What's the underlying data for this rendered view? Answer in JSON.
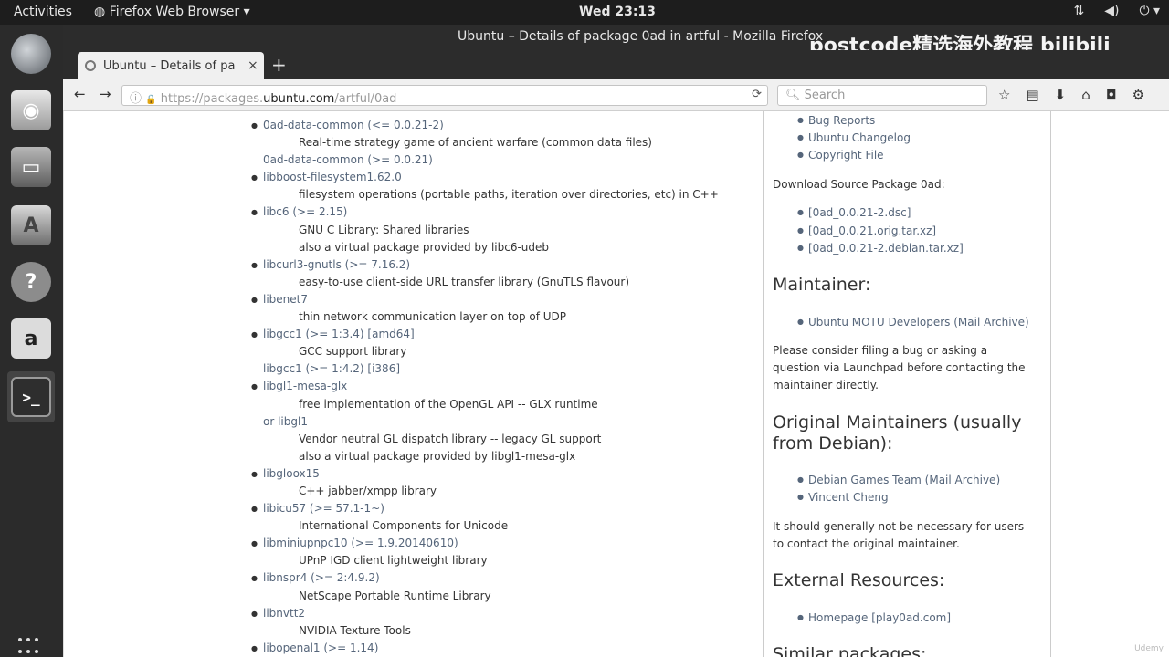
{
  "topbar": {
    "activities": "Activities",
    "app": "Firefox Web Browser ▾",
    "clock": "Wed 23:13"
  },
  "window_title": "Ubuntu – Details of package 0ad in artful - Mozilla Firefox",
  "watermark": "postcode精选海外教程 bilibili",
  "tab": {
    "label": "Ubuntu – Details of pa",
    "close": "×",
    "new": "+"
  },
  "nav": {
    "back": "←",
    "forward": "→",
    "info": "ⓘ",
    "lock": "🔒",
    "url_scheme": "https://packages.",
    "url_host": "ubuntu.com",
    "url_path": "/artful/0ad",
    "reload": "⟳",
    "search_placeholder": "Search"
  },
  "dependencies": [
    {
      "kind": "bullet",
      "text": "0ad-data-common (<= 0.0.21-2)"
    },
    {
      "kind": "desc",
      "text": "Real-time strategy game of ancient warfare (common data files)"
    },
    {
      "kind": "alt",
      "text": "0ad-data-common (>= 0.0.21)"
    },
    {
      "kind": "bullet",
      "text": "libboost-filesystem1.62.0"
    },
    {
      "kind": "desc",
      "text": "filesystem operations (portable paths, iteration over directories, etc) in C++"
    },
    {
      "kind": "bullet",
      "text": "libc6 (>= 2.15)"
    },
    {
      "kind": "desc",
      "text": "GNU C Library: Shared libraries"
    },
    {
      "kind": "desc",
      "text": "also a virtual package provided by libc6-udeb"
    },
    {
      "kind": "bullet",
      "text": "libcurl3-gnutls (>= 7.16.2)"
    },
    {
      "kind": "desc",
      "text": "easy-to-use client-side URL transfer library (GnuTLS flavour)"
    },
    {
      "kind": "bullet",
      "text": "libenet7"
    },
    {
      "kind": "desc",
      "text": "thin network communication layer on top of UDP"
    },
    {
      "kind": "bullet",
      "text": "libgcc1 (>= 1:3.4) [amd64]"
    },
    {
      "kind": "desc",
      "text": "GCC support library"
    },
    {
      "kind": "alt",
      "text": "libgcc1 (>= 1:4.2) [i386]"
    },
    {
      "kind": "bullet",
      "text": "libgl1-mesa-glx"
    },
    {
      "kind": "desc",
      "text": "free implementation of the OpenGL API -- GLX runtime"
    },
    {
      "kind": "alt",
      "text": "or libgl1"
    },
    {
      "kind": "desc",
      "text": "Vendor neutral GL dispatch library -- legacy GL support"
    },
    {
      "kind": "desc",
      "text": "also a virtual package provided by libgl1-mesa-glx"
    },
    {
      "kind": "bullet",
      "text": "libgloox15"
    },
    {
      "kind": "desc",
      "text": "C++ jabber/xmpp library"
    },
    {
      "kind": "bullet",
      "text": "libicu57 (>= 57.1-1~)"
    },
    {
      "kind": "desc",
      "text": "International Components for Unicode"
    },
    {
      "kind": "bullet",
      "text": "libminiupnpc10 (>= 1.9.20140610)"
    },
    {
      "kind": "desc",
      "text": "UPnP IGD client lightweight library"
    },
    {
      "kind": "bullet",
      "text": "libnspr4 (>= 2:4.9.2)"
    },
    {
      "kind": "desc",
      "text": "NetScape Portable Runtime Library"
    },
    {
      "kind": "bullet",
      "text": "libnvtt2"
    },
    {
      "kind": "desc",
      "text": "NVIDIA Texture Tools"
    },
    {
      "kind": "bullet",
      "text": "libopenal1 (>= 1.14)"
    }
  ],
  "sidebar": {
    "links": [
      "Bug Reports",
      "Ubuntu Changelog",
      "Copyright File"
    ],
    "download_heading": "Download Source Package 0ad:",
    "downloads": [
      "[0ad_0.0.21-2.dsc]",
      "[0ad_0.0.21.orig.tar.xz]",
      "[0ad_0.0.21-2.debian.tar.xz]"
    ],
    "maintainer_heading": "Maintainer:",
    "maintainer": "Ubuntu MOTU Developers (Mail Archive)",
    "maintainer_note": "Please consider filing a bug or asking a question via Launchpad before contacting the maintainer directly.",
    "orig_heading": "Original Maintainers (usually from Debian):",
    "orig_maintainers": [
      "Debian Games Team (Mail Archive)",
      "Vincent Cheng"
    ],
    "orig_note": "It should generally not be necessary for users to contact the original maintainer.",
    "external_heading": "External Resources:",
    "homepage": "Homepage [play0ad.com]",
    "similar_heading": "Similar packages:"
  },
  "corner_mark": "Udemy"
}
